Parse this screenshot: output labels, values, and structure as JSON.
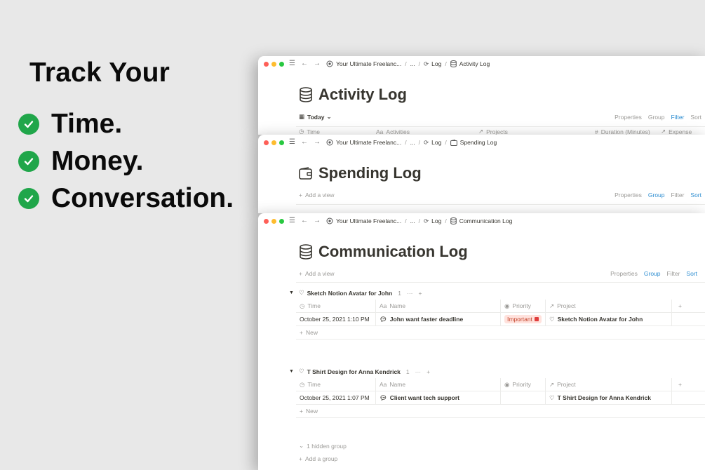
{
  "promo": {
    "headline": "Track Your",
    "items": [
      "Time.",
      "Money.",
      "Conversation."
    ]
  },
  "windows": {
    "activity": {
      "breadcrumb": [
        "Your Ultimate Freelanc...",
        "...",
        "Log",
        "Activity Log"
      ],
      "title": "Activity Log",
      "view_label": "Today",
      "actions": [
        "Properties",
        "Group",
        "Filter",
        "Sort"
      ],
      "columns": [
        "Time",
        "Activities",
        "Projects",
        "Duration (Minutes)",
        "Expense"
      ]
    },
    "spending": {
      "breadcrumb": [
        "Your Ultimate Freelanc...",
        "...",
        "Log",
        "Spending Log"
      ],
      "title": "Spending Log",
      "add_view": "Add a view",
      "actions": [
        "Properties",
        "Group",
        "Filter",
        "Sort"
      ]
    },
    "communication": {
      "breadcrumb": [
        "Your Ultimate Freelanc...",
        "...",
        "Log",
        "Communication Log"
      ],
      "title": "Communication Log",
      "add_view": "Add a view",
      "actions": [
        "Properties",
        "Group",
        "Filter",
        "Sort"
      ],
      "columns": [
        "Time",
        "Name",
        "Priority",
        "Project"
      ],
      "groups": [
        {
          "name": "Sketch Notion Avatar for John",
          "count": "1",
          "row": {
            "time": "October 25, 2021 1:10 PM",
            "name": "John want faster deadline",
            "priority": "Important",
            "project": "Sketch Notion Avatar for John"
          },
          "new_label": "New"
        },
        {
          "name": "T Shirt Design for Anna Kendrick",
          "count": "1",
          "row": {
            "time": "October 25, 2021 1:07 PM",
            "name": "Client want tech support",
            "priority": "",
            "project": "T Shirt Design for Anna Kendrick"
          },
          "new_label": "New"
        }
      ],
      "hidden_group": "1 hidden group",
      "add_group": "Add a group"
    }
  },
  "colors": {
    "check_green": "#20a64a",
    "link_blue": "#2e8ed1",
    "important_bg": "#ffe2dd",
    "important_text": "#c4452c"
  }
}
